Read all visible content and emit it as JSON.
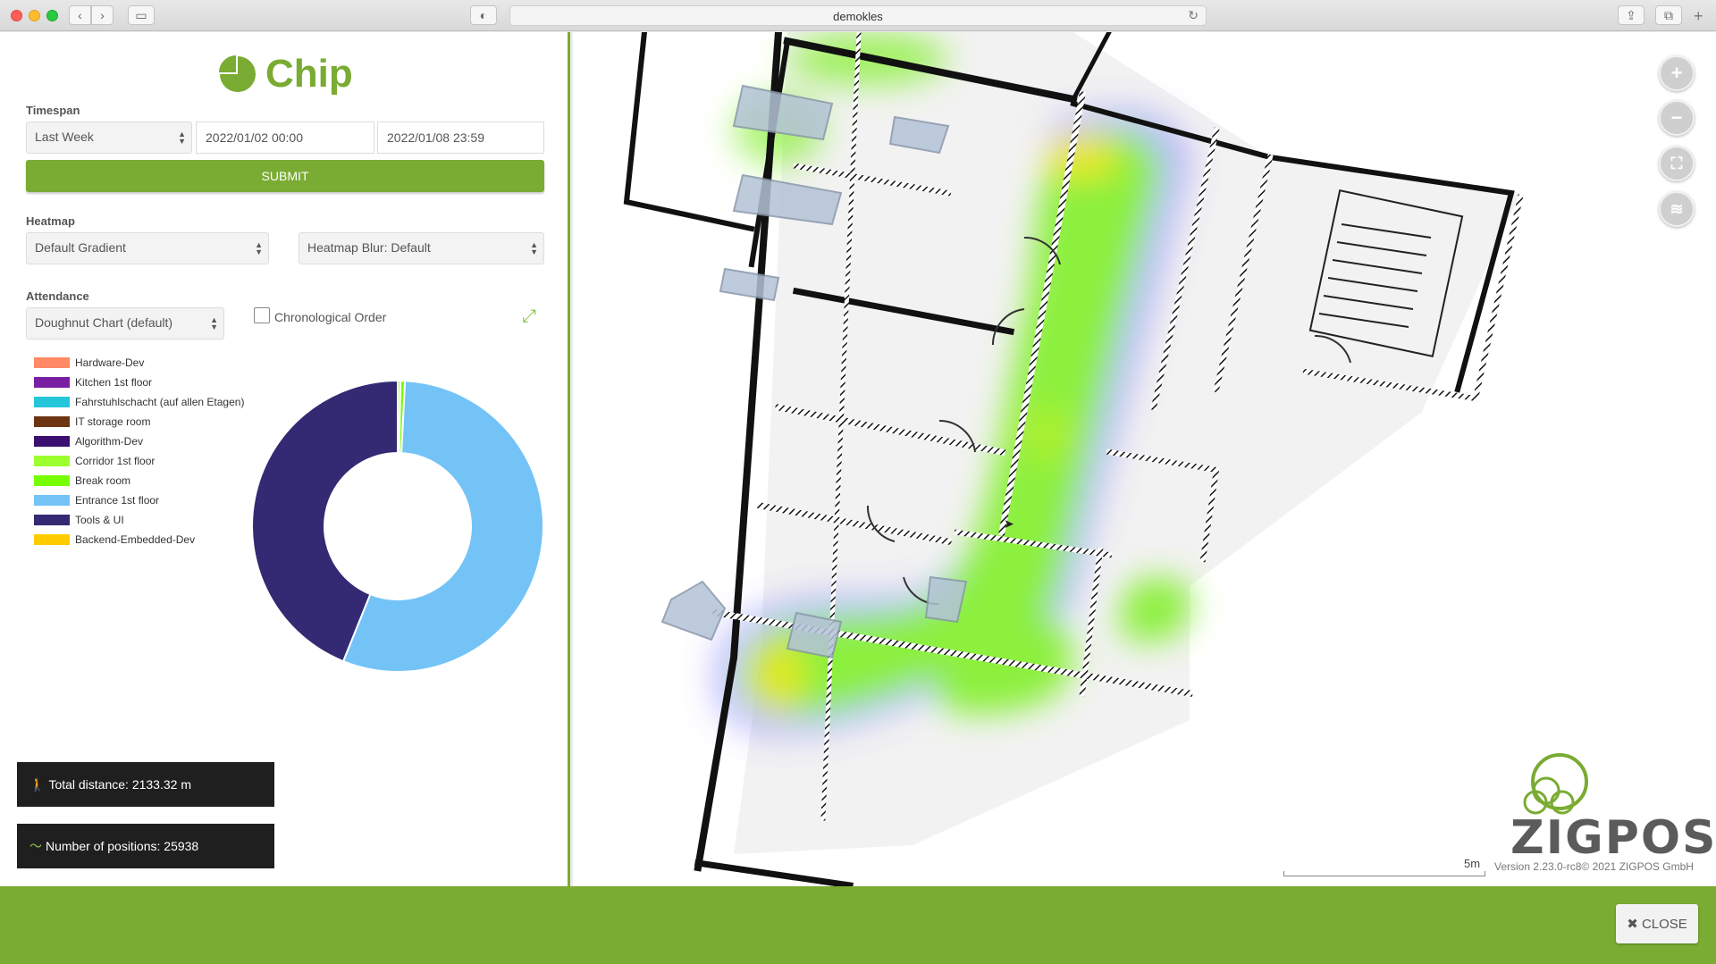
{
  "browser": {
    "url": "demokles",
    "icons": [
      "chevron-left-icon",
      "chevron-right-icon",
      "sidebar-icon",
      "shield-icon",
      "reload-icon",
      "share-icon",
      "tabs-icon",
      "plus-icon"
    ]
  },
  "app": {
    "title": "Chip",
    "accent_color": "#7aab32"
  },
  "timespan": {
    "label": "Timespan",
    "preset": "Last Week",
    "start": "2022/01/02 00:00",
    "end": "2022/01/08 23:59",
    "submit_label": "SUBMIT"
  },
  "heatmap": {
    "label": "Heatmap",
    "gradient": "Default Gradient",
    "blur": "Heatmap Blur: Default"
  },
  "attendance": {
    "label": "Attendance",
    "chart_type": "Doughnut Chart (default)",
    "chronological_label": "Chronological Order",
    "chronological_checked": false
  },
  "legend": [
    {
      "label": "Hardware-Dev",
      "color": "#ff8a65"
    },
    {
      "label": "Kitchen 1st floor",
      "color": "#7b1fa2"
    },
    {
      "label": "Fahrstuhlschacht (auf allen Etagen)",
      "color": "#26c6da"
    },
    {
      "label": "IT storage room",
      "color": "#6d3412"
    },
    {
      "label": "Algorithm-Dev",
      "color": "#3b0f6f"
    },
    {
      "label": "Corridor 1st floor",
      "color": "#9cff2e"
    },
    {
      "label": "Break room",
      "color": "#76ff03"
    },
    {
      "label": "Entrance 1st floor",
      "color": "#73c3f7"
    },
    {
      "label": "Tools & UI",
      "color": "#332a73"
    },
    {
      "label": "Backend-Embedded-Dev",
      "color": "#ffcc00"
    }
  ],
  "chart_data": {
    "type": "doughnut",
    "categories": [
      "Hardware-Dev",
      "Kitchen 1st floor",
      "Fahrstuhlschacht (auf allen Etagen)",
      "IT storage room",
      "Algorithm-Dev",
      "Corridor 1st floor",
      "Break room",
      "Entrance 1st floor",
      "Tools & UI",
      "Backend-Embedded-Dev"
    ],
    "values": [
      0,
      0,
      0,
      0,
      0,
      0.3,
      0.5,
      55.3,
      43.9,
      0
    ],
    "colors": [
      "#ff8a65",
      "#7b1fa2",
      "#26c6da",
      "#6d3412",
      "#3b0f6f",
      "#9cff2e",
      "#76ff03",
      "#73c3f7",
      "#332a73",
      "#ffcc00"
    ]
  },
  "stats": {
    "distance": "Total distance: 2133.32 m",
    "positions": "Number of positions: 25938"
  },
  "map": {
    "controls": [
      "plus-icon",
      "minus-icon",
      "fullscreen-icon",
      "layers-icon"
    ],
    "scale_label": "5m",
    "brand": "ZIGPOS",
    "version": "Version 2.23.0-rc8© 2021 ZIGPOS GmbH"
  },
  "footer": {
    "close_label": "✖ CLOSE"
  }
}
